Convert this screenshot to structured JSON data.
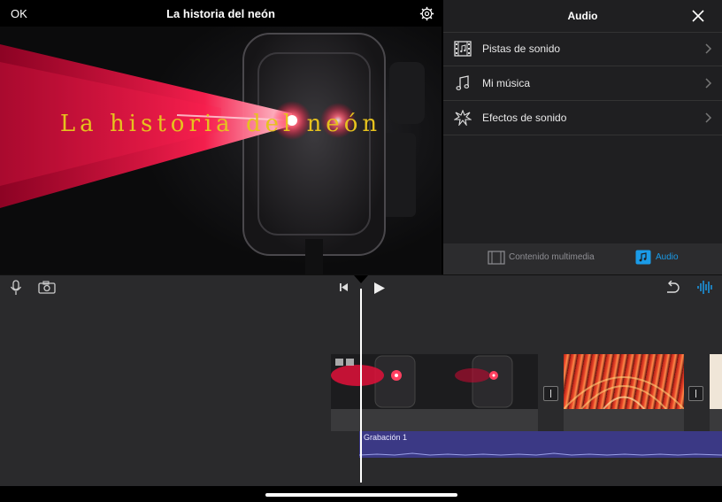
{
  "topbar": {
    "ok_label": "OK",
    "project_title": "La historia del neón"
  },
  "viewer": {
    "overlay_title": "La historia del neón"
  },
  "audio_panel": {
    "title": "Audio",
    "items": [
      {
        "label": "Pistas de sonido",
        "icon": "film-strip-icon"
      },
      {
        "label": "Mi música",
        "icon": "music-note-icon"
      },
      {
        "label": "Efectos de sonido",
        "icon": "burst-icon"
      }
    ],
    "tabs": [
      {
        "label": "Contenido multimedia",
        "icon": "film-icon",
        "active": false
      },
      {
        "label": "Audio",
        "icon": "music-note-icon",
        "active": true
      }
    ]
  },
  "timeline": {
    "audio_clip_label": "Grabación 1"
  },
  "colors": {
    "accent": "#1a9be8",
    "title_yellow": "#e6c21e",
    "audio_track": "#3b3985"
  }
}
